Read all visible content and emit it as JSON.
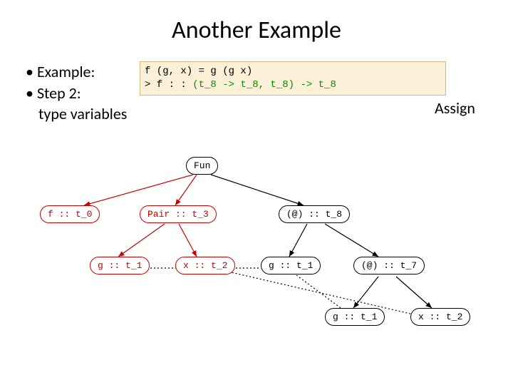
{
  "title": "Another Example",
  "bullets": {
    "b1": "Example:",
    "b2": "Step 2:",
    "b3": "type variables"
  },
  "assign_label": "Assign",
  "code": {
    "line1": "f (g, x) = g (g x)",
    "line2_prefix": "> f : : ",
    "line2_type": "(t_8 -> t_8, t_8) -> t_8"
  },
  "nodes": {
    "fun": "Fun",
    "f": "f :: t_0",
    "pair": "Pair :: t_3",
    "app8": "(@) :: t_8",
    "g1": "g :: t_1",
    "x2": "x :: t_2",
    "g1b": "g :: t_1",
    "app7": "(@) :: t_7",
    "g1c": "g :: t_1",
    "x2b": "x :: t_2"
  },
  "colors": {
    "red": "#c00",
    "black": "#000",
    "code_bg": "#fdf0d8",
    "code_border": "#d5b97d",
    "type_green": "#009000",
    "type_blue": "#0000d0"
  }
}
